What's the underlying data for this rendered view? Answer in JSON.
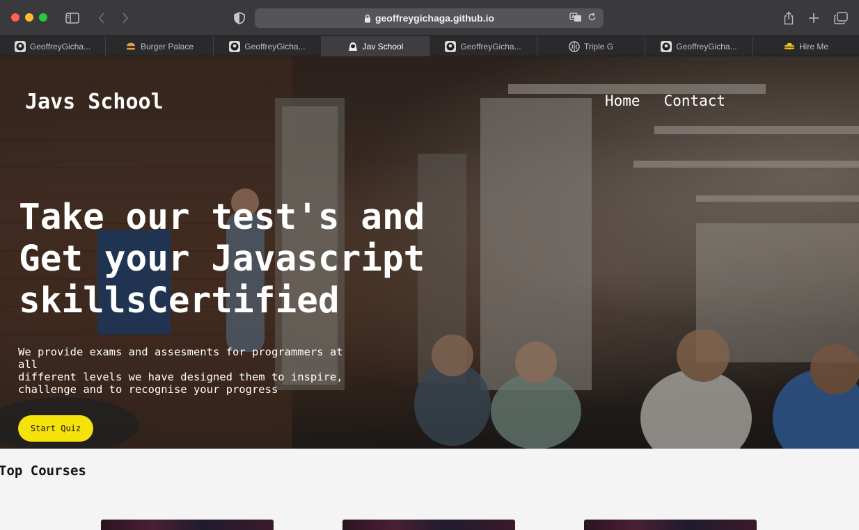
{
  "browser": {
    "url": "geoffreygichaga.github.io",
    "tabs": [
      {
        "label": "GeoffreyGicha...",
        "icon": "github-icon",
        "active": false
      },
      {
        "label": "Burger Palace",
        "icon": "burger-icon",
        "active": false
      },
      {
        "label": "GeoffreyGicha...",
        "icon": "github-icon",
        "active": false
      },
      {
        "label": "Jav School",
        "icon": "hacker-icon",
        "active": true
      },
      {
        "label": "GeoffreyGicha...",
        "icon": "github-icon",
        "active": false
      },
      {
        "label": "Triple G",
        "icon": "brain-icon",
        "active": false
      },
      {
        "label": "GeoffreyGicha...",
        "icon": "github-icon",
        "active": false
      },
      {
        "label": "Hire Me",
        "icon": "taxi-icon",
        "active": false
      }
    ]
  },
  "site": {
    "brand": "Javs School",
    "nav": [
      {
        "label": "Home"
      },
      {
        "label": "Contact"
      }
    ],
    "hero": {
      "title_lines": [
        "Take our test's and",
        "Get your Javascript",
        "skillsCertified"
      ],
      "subtitle_lines": [
        "We provide exams and assesments for programmers at all",
        "different levels we have designed them to inspire,",
        "challenge and to recognise your progress"
      ],
      "cta_label": "Start Quiz",
      "cta_color": "#f5e20b"
    },
    "section_title": "Top Courses"
  }
}
